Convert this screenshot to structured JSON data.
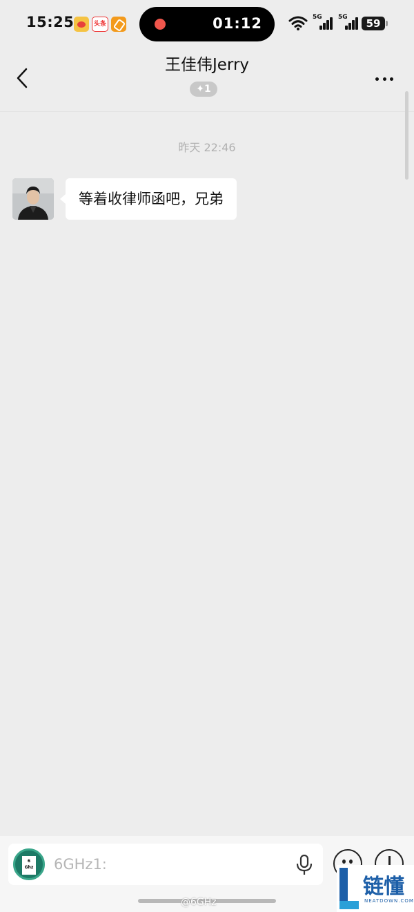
{
  "status_bar": {
    "time": "15:25",
    "app_icons": [
      "weibo-icon",
      "toutiao-icon",
      "zhihu-icon"
    ],
    "toutiao_label": "头条",
    "recording_time": "01:12",
    "recording_dot_color": "#f0564c",
    "signal_1": "5G",
    "signal_2": "5G",
    "battery": "59"
  },
  "nav": {
    "title": "王佳伟Jerry",
    "badge": "✦1"
  },
  "chat": {
    "timestamp": "昨天 22:46",
    "messages": [
      {
        "sender": "incoming",
        "text": "等着收律师函吧，兄弟"
      }
    ]
  },
  "input": {
    "value": "6GHz1:",
    "icons": [
      "mic-icon",
      "emoji-icon",
      "plus-icon"
    ]
  },
  "watermark": "@6GHz",
  "logo": {
    "text": "链懂",
    "sub": "NEATDOWN.COM"
  },
  "colors": {
    "background": "#ededed",
    "bubble": "#ffffff",
    "logo": "#1d5fa8"
  }
}
